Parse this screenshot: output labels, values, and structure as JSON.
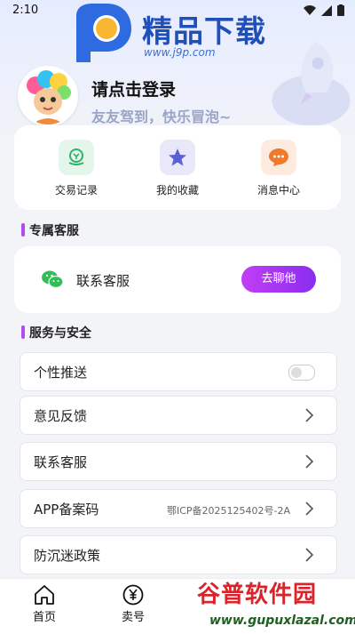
{
  "status_bar": {
    "time": "2:10"
  },
  "watermark_top": {
    "title": "精品下载",
    "url": "www.j9p.com"
  },
  "profile": {
    "login_text": "请点击登录",
    "subtitle": "友友驾到，快乐冒泡~"
  },
  "quick_actions": [
    {
      "label": "交易记录",
      "icon": "transaction-record-icon",
      "bg": "#e4f6ec",
      "color": "#2db36a"
    },
    {
      "label": "我的收藏",
      "icon": "star-icon",
      "bg": "#e8e8f8",
      "color": "#5b5fd6"
    },
    {
      "label": "消息中心",
      "icon": "message-icon",
      "bg": "#fdebe0",
      "color": "#f07a2b"
    }
  ],
  "exclusive_service": {
    "section_title": "专属客服",
    "label": "联系客服",
    "button_label": "去聊他",
    "icon": "wechat-icon",
    "accent": "#9b35f2"
  },
  "services_security": {
    "section_title": "服务与安全",
    "items": [
      {
        "label": "个性推送",
        "type": "toggle",
        "checked": false
      },
      {
        "label": "意见反馈",
        "type": "link"
      },
      {
        "label": "联系客服",
        "type": "link"
      },
      {
        "label": "APP备案码",
        "type": "link",
        "value": "鄂ICP备2025125402号-2A"
      },
      {
        "label": "防沉迷政策",
        "type": "link"
      }
    ]
  },
  "tab_bar": [
    {
      "label": "首页",
      "icon": "home-icon"
    },
    {
      "label": "卖号",
      "icon": "yuan-icon"
    }
  ],
  "watermark_bottom": {
    "title": "谷普软件园",
    "url": "www.gupuxlazal.com"
  }
}
